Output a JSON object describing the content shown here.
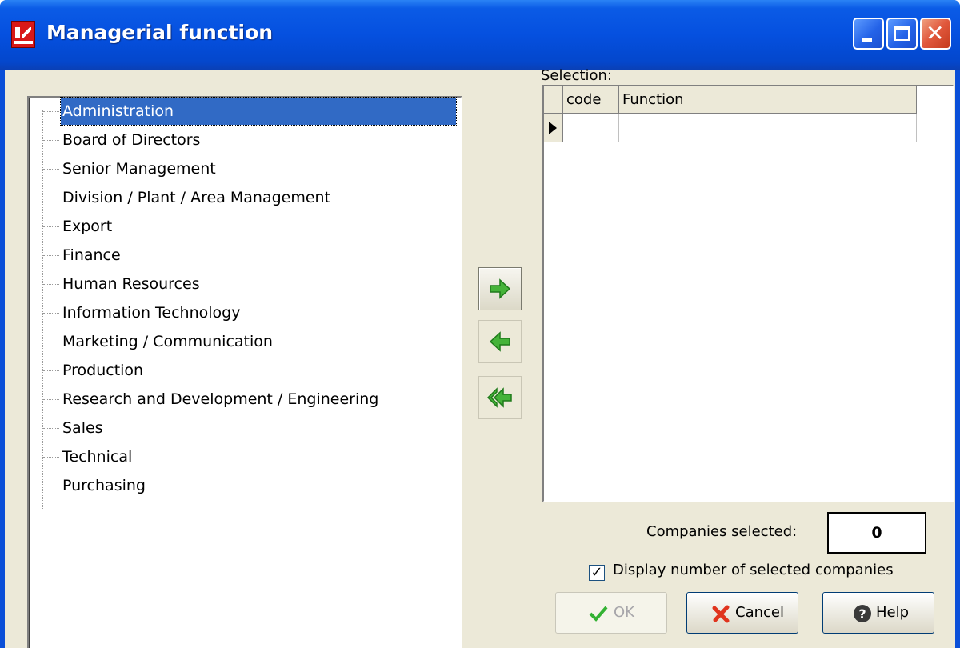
{
  "window": {
    "title": "Managerial function",
    "controls": {
      "minimize": "minimize",
      "maximize": "maximize",
      "close": "close"
    }
  },
  "tree": {
    "selected": "Administration",
    "items": [
      "Administration",
      "Board of Directors",
      "Senior Management",
      "Division / Plant / Area Management",
      "Export",
      "Finance",
      "Human Resources",
      "Information Technology",
      "Marketing / Communication",
      "Production",
      "Research and Development / Engineering",
      "Sales",
      "Technical",
      "Purchasing"
    ]
  },
  "transfer": {
    "add_icon": "arrow-right-icon",
    "remove_icon": "arrow-left-icon",
    "remove_all_icon": "double-arrow-left-icon"
  },
  "selection": {
    "label": "Selection:",
    "columns": [
      "code",
      "Function"
    ],
    "rows": [
      {
        "code": "",
        "function": ""
      }
    ]
  },
  "companies": {
    "label": "Companies selected:",
    "value": "0"
  },
  "display_checkbox": {
    "label": "Display number of selected companies",
    "checked": true
  },
  "buttons": {
    "ok": {
      "label": "OK",
      "icon": "checkmark-icon",
      "enabled": false
    },
    "cancel": {
      "label": "Cancel",
      "icon": "x-icon"
    },
    "help": {
      "label": "Help",
      "icon": "help-icon"
    }
  },
  "colors": {
    "titlebar": "#0550df",
    "client": "#ece9d8",
    "selection": "#316ac5",
    "arrow_green": "#3aa53a"
  }
}
